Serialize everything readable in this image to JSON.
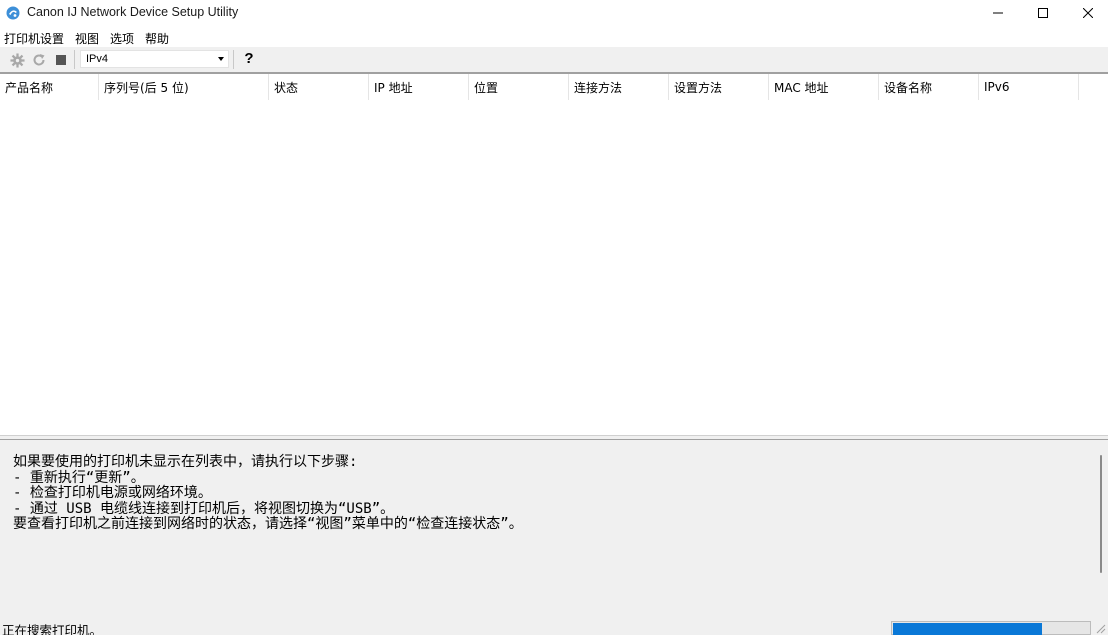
{
  "window": {
    "title": "Canon IJ Network Device Setup Utility"
  },
  "menu": {
    "items": [
      "打印机设置",
      "视图",
      "选项",
      "帮助"
    ]
  },
  "toolbar": {
    "network_combo_value": "IPv4",
    "help_label": "?"
  },
  "list": {
    "columns": [
      "产品名称",
      "序列号(后 5 位)",
      "状态",
      "IP 地址",
      "位置",
      "连接方法",
      "设置方法",
      "MAC 地址",
      "设备名称",
      "IPv6"
    ],
    "rows": []
  },
  "info": {
    "lines": [
      "如果要使用的打印机未显示在列表中，请执行以下步骤:",
      "- 重新执行“更新”。",
      "- 检查打印机电源或网络环境。",
      "- 通过 USB 电缆线连接到打印机后，将视图切换为“USB”。",
      "要查看打印机之前连接到网络时的状态，请选择“视图”菜单中的“检查连接状态”。"
    ]
  },
  "status": {
    "text": "正在搜索打印机。",
    "progress_fraction": 0.76
  },
  "colors": {
    "accent": "#0a78d7",
    "panel_bg": "#f0f0f0"
  },
  "icons": [
    "app-icon",
    "minimize-icon",
    "maximize-icon",
    "close-icon",
    "settings-gear-icon",
    "refresh-icon",
    "stop-icon",
    "dropdown-arrow-icon",
    "help-icon",
    "resize-grip-icon"
  ]
}
